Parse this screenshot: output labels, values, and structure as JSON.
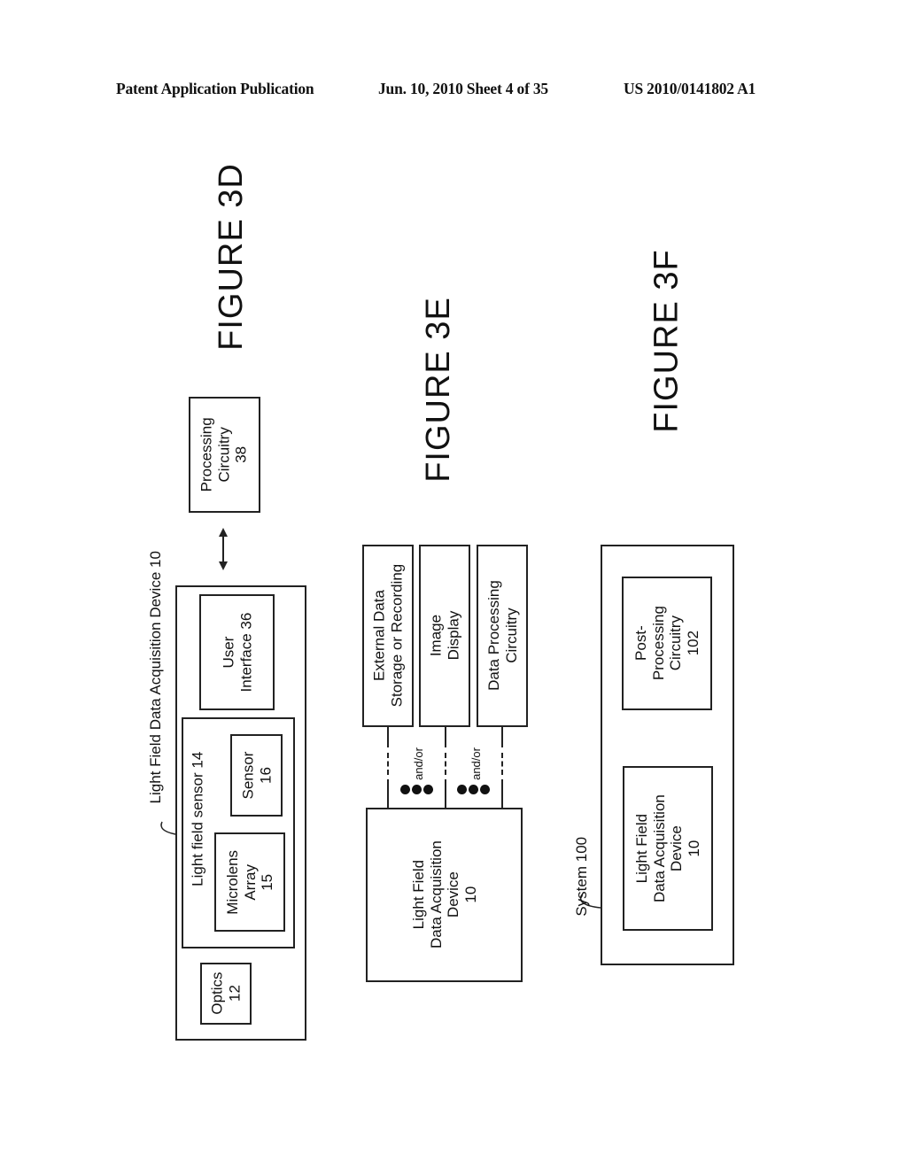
{
  "header": {
    "publication": "Patent Application Publication",
    "date_sheet": "Jun. 10, 2010   Sheet 4 of 35",
    "patent_number": "US 2010/0141802 A1"
  },
  "figure_3d": {
    "label": "FIGURE 3D",
    "device_label": "Light Field Data Acquisition Device 10",
    "sensor_group_label": "Light field sensor 14",
    "optics": "Optics\n12",
    "microlens": "Microlens\nArray\n15",
    "sensor": "Sensor\n16",
    "user_interface": "User\nInterface 36",
    "processing": "Processing\nCircuitry\n38"
  },
  "figure_3e": {
    "label": "FIGURE 3E",
    "external_storage": "External Data\nStorage or Recording",
    "image_display": "Image\nDisplay",
    "data_processing": "Data Processing\nCircuitry",
    "connector_label_1": "and/or",
    "connector_label_2": "and/or",
    "device": "Light Field\nData Acquisition\nDevice\n10"
  },
  "figure_3f": {
    "label": "FIGURE 3F",
    "system_label": "System 100",
    "post_processing": "Post-\nProcessing\nCircuitry\n102",
    "device": "Light Field\nData Acquisition\nDevice\n10"
  }
}
